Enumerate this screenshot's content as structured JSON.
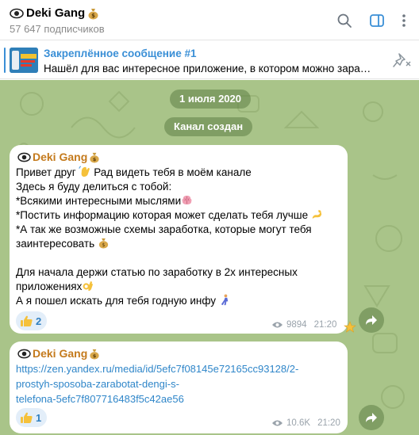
{
  "header": {
    "channel_name": "Deki Gang",
    "subscribers": "57 647 подписчиков"
  },
  "pinned": {
    "title": "Закреплённое сообщение #1",
    "preview": "Нашёл для вас интересное приложение, в котором можно зарабатывать"
  },
  "service": {
    "date": "1 июля 2020",
    "created": "Канал создан"
  },
  "message1": {
    "sender": "Deki Gang",
    "lines": [
      "Привет друг",
      "Рад видеть тебя в моём канале",
      "Здесь я буду делиться с тобой:",
      "*Всякими интересными мыслями",
      "*Постить информацию которая может сделать тебя лучше",
      "*А так же возможные схемы заработка, которые могут тебя",
      "заинтересовать",
      "Для начала держи статью по заработку в 2х интересных",
      "приложениях",
      "А я пошел искать для тебя годную инфу"
    ],
    "reaction_count": "2",
    "views": "9894",
    "time": "21:20"
  },
  "message2": {
    "sender": "Deki Gang",
    "link_lines": [
      "https://zen.yandex.ru/media/id/5efc7f08145e72165cc93128/2-",
      "prostyh-sposoba-zarabotat-dengi-s-",
      "telefona-5efc7f807716483f5c42ae56"
    ],
    "reaction_count": "1",
    "views": "10.6K",
    "time": "21:20"
  },
  "icons": {
    "eye": "eye-icon",
    "money_bag": "money-bag-icon",
    "search": "search-icon",
    "sidebar": "sidebar-toggle-icon",
    "unpin": "unpin-icon",
    "thumbs_up": "thumbs-up-icon",
    "forward": "forward-icon",
    "star": "star-icon"
  },
  "colors": {
    "accent": "#3a8fd6",
    "sender": "#c47a1c",
    "chat_bg": "#a9c489",
    "link": "#2f86c9"
  }
}
